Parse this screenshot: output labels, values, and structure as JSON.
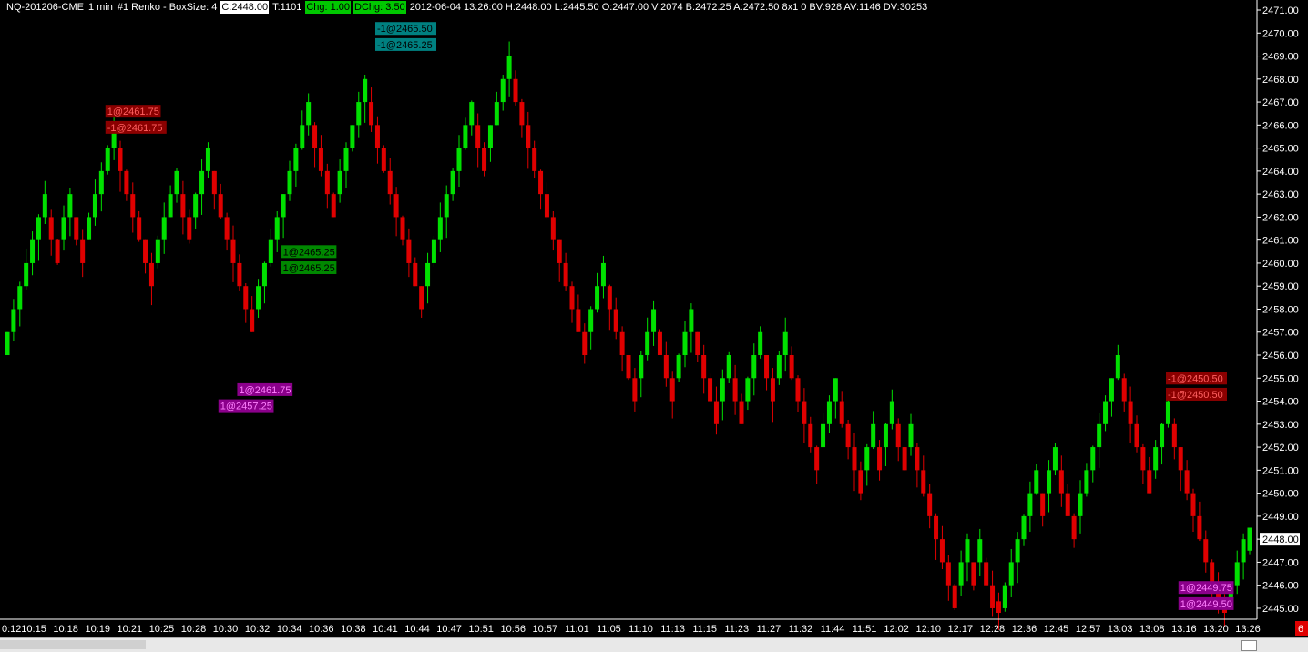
{
  "header": {
    "symbol": "NQ-201206-CME",
    "interval": "1 min",
    "study": "#1 Renko - BoxSize: 4",
    "close": "C:2448.00",
    "trades": "T:1101",
    "chg": "Chg: 1.00",
    "dchg": "DChg: 3.50",
    "stats": "2012-06-04 13:26:00 H:2448.00 L:2445.50 O:2447.00 V:2074 B:2472.25 A:2472.50 8x1 0 BV:928 AV:1146 DV:30253"
  },
  "colors": {
    "background": "#000000",
    "up": "#00e000",
    "down": "#e00000",
    "axis": "#ffffff"
  },
  "chart_data": {
    "type": "renko",
    "ylim": [
      2444.8,
      2471.0
    ],
    "y_ticks": [
      "2471.00",
      "2470.00",
      "2469.00",
      "2468.00",
      "2467.00",
      "2466.00",
      "2465.00",
      "2464.00",
      "2463.00",
      "2462.00",
      "2461.00",
      "2460.00",
      "2459.00",
      "2458.00",
      "2457.00",
      "2456.00",
      "2455.00",
      "2454.00",
      "2453.00",
      "2452.00",
      "2451.00",
      "2450.00",
      "2449.00",
      "2448.00",
      "2447.00",
      "2446.00",
      "2445.00"
    ],
    "last_price_label": "2448.00",
    "last_price": 2448.0,
    "x_labels": [
      "0:12",
      "10:15",
      "10:18",
      "10:19",
      "10:21",
      "10:25",
      "10:28",
      "10:30",
      "10:32",
      "10:34",
      "10:36",
      "10:38",
      "10:41",
      "10:44",
      "10:47",
      "10:51",
      "10:56",
      "10:57",
      "11:01",
      "11:05",
      "11:10",
      "11:13",
      "11:15",
      "11:23",
      "11:27",
      "11:32",
      "11:44",
      "11:51",
      "12:02",
      "12:10",
      "12:17",
      "12:28",
      "12:36",
      "12:45",
      "12:57",
      "13:03",
      "13:08",
      "13:16",
      "13:20",
      "13:26"
    ],
    "marker_label": "6",
    "brick_values": [
      2456.5,
      2457.5,
      2458.5,
      2459.5,
      2460.5,
      2461.5,
      2462.5,
      2461.5,
      2460.5,
      2461.5,
      2462.5,
      2461.5,
      2460.5,
      2461.5,
      2462.5,
      2463.5,
      2464.5,
      2465.5,
      2464.5,
      2463.5,
      2462.5,
      2461.5,
      2460.5,
      2459.5,
      2460.5,
      2461.5,
      2462.5,
      2463.5,
      2462.5,
      2461.5,
      2462.5,
      2463.5,
      2464.5,
      2463.5,
      2462.5,
      2461.5,
      2460.5,
      2459.5,
      2458.5,
      2457.5,
      2458.5,
      2459.5,
      2460.5,
      2461.5,
      2462.5,
      2463.5,
      2464.5,
      2465.5,
      2466.5,
      2465.5,
      2464.5,
      2463.5,
      2462.5,
      2463.5,
      2464.5,
      2465.5,
      2466.5,
      2467.5,
      2466.5,
      2465.5,
      2464.5,
      2463.5,
      2462.5,
      2461.5,
      2460.5,
      2459.5,
      2458.5,
      2459.5,
      2460.5,
      2461.5,
      2462.5,
      2463.5,
      2464.5,
      2465.5,
      2466.5,
      2465.5,
      2464.5,
      2465.5,
      2466.5,
      2467.5,
      2468.5,
      2467.5,
      2466.5,
      2465.5,
      2464.5,
      2463.5,
      2462.5,
      2461.5,
      2460.5,
      2459.5,
      2458.5,
      2457.5,
      2456.5,
      2457.5,
      2458.5,
      2459.5,
      2458.5,
      2457.5,
      2456.5,
      2455.5,
      2454.5,
      2455.5,
      2456.5,
      2457.5,
      2456.5,
      2455.5,
      2454.5,
      2455.5,
      2456.5,
      2457.5,
      2456.5,
      2455.5,
      2454.5,
      2453.5,
      2454.5,
      2455.5,
      2454.5,
      2453.5,
      2454.5,
      2455.5,
      2456.5,
      2455.5,
      2454.5,
      2455.5,
      2456.5,
      2455.5,
      2454.5,
      2453.5,
      2452.5,
      2451.5,
      2452.5,
      2453.5,
      2454.5,
      2453.5,
      2452.5,
      2451.5,
      2450.5,
      2451.5,
      2452.5,
      2451.5,
      2452.5,
      2453.5,
      2452.5,
      2451.5,
      2452.5,
      2451.5,
      2450.5,
      2449.5,
      2448.5,
      2447.5,
      2446.5,
      2445.5,
      2446.5,
      2447.5,
      2446.5,
      2447.5,
      2446.5,
      2445.5,
      2444.8,
      2445.5,
      2446.5,
      2447.5,
      2448.5,
      2449.5,
      2450.5,
      2449.5,
      2450.5,
      2451.5,
      2450.5,
      2449.5,
      2448.5,
      2449.5,
      2450.5,
      2451.5,
      2452.5,
      2453.5,
      2454.5,
      2455.5,
      2454.5,
      2453.5,
      2452.5,
      2451.5,
      2450.5,
      2451.5,
      2452.5,
      2453.5,
      2452.5,
      2451.5,
      2450.5,
      2449.5,
      2448.5,
      2447.5,
      2446.5,
      2445.5,
      2444.8,
      2445.5,
      2446.5,
      2447.5,
      2448.0
    ],
    "trade_labels": [
      {
        "text": "1@2461.75",
        "color": "red",
        "price": 2466.6,
        "index": 20
      },
      {
        "text": "-1@2461.75",
        "color": "red",
        "price": 2465.9,
        "index": 20
      },
      {
        "text": "-1@2465.50",
        "color": "teal",
        "price": 2470.2,
        "index": 63
      },
      {
        "text": "-1@2465.25",
        "color": "teal",
        "price": 2469.5,
        "index": 63
      },
      {
        "text": "1@2465.25",
        "color": "green",
        "price": 2460.5,
        "index": 48
      },
      {
        "text": "1@2465.25",
        "color": "green",
        "price": 2459.8,
        "index": 48
      },
      {
        "text": "1@2461.75",
        "color": "purple",
        "price": 2454.5,
        "index": 41
      },
      {
        "text": "1@2457.25",
        "color": "purple",
        "price": 2453.8,
        "index": 38
      },
      {
        "text": "-1@2450.50",
        "color": "red",
        "price": 2455.0,
        "index": 189
      },
      {
        "text": "-1@2450.50",
        "color": "red",
        "price": 2454.3,
        "index": 189
      },
      {
        "text": "1@2449.75",
        "color": "purple",
        "price": 2445.9,
        "index": 191
      },
      {
        "text": "1@2449.50",
        "color": "purple",
        "price": 2445.2,
        "index": 191
      }
    ],
    "grid": false
  }
}
